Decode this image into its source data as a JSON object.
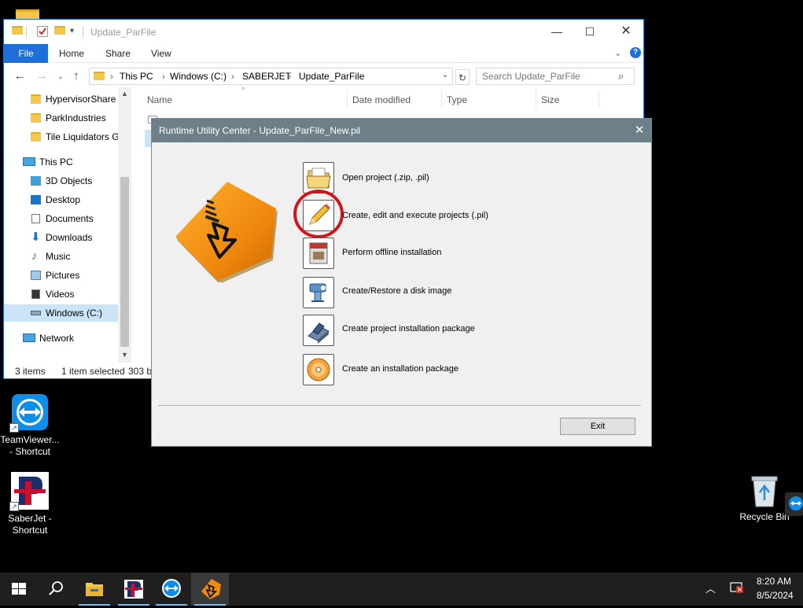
{
  "desktop": {
    "icons": [
      {
        "label": "TeamViewer... - Shortcut"
      },
      {
        "label": "SaberJet - Shortcut"
      },
      {
        "label": "Recycle Bin"
      }
    ]
  },
  "explorer": {
    "title": "Update_ParFile",
    "ribbon_tabs": [
      "File",
      "Home",
      "Share",
      "View"
    ],
    "breadcrumb": [
      "This PC",
      "Windows (C:)",
      "SABERJET",
      "Update_ParFile"
    ],
    "search_placeholder": "Search Update_ParFile",
    "nav_items": [
      {
        "label": "HypervisorShare",
        "icon": "folder-icon"
      },
      {
        "label": "ParkIndustries",
        "icon": "folder-icon"
      },
      {
        "label": "Tile Liquidators G",
        "icon": "folder-icon"
      },
      {
        "label": "This PC",
        "icon": "pc-icon"
      },
      {
        "label": "3D Objects",
        "icon": "cube-icon"
      },
      {
        "label": "Desktop",
        "icon": "desktop-icon"
      },
      {
        "label": "Documents",
        "icon": "document-icon"
      },
      {
        "label": "Downloads",
        "icon": "download-icon"
      },
      {
        "label": "Music",
        "icon": "music-icon"
      },
      {
        "label": "Pictures",
        "icon": "picture-icon"
      },
      {
        "label": "Videos",
        "icon": "video-icon"
      },
      {
        "label": "Windows (C:)",
        "icon": "drive-icon"
      },
      {
        "label": "Network",
        "icon": "network-icon"
      }
    ],
    "columns": [
      "Name",
      "Date modified",
      "Type",
      "Size"
    ],
    "status": {
      "items": "3 items",
      "selected": "1 item selected",
      "size": "303 b"
    }
  },
  "dialog": {
    "title": "Runtime Utility Center - Update_ParFile_New.pil",
    "options": [
      {
        "label": "Open project (.zip, .pil)",
        "icon": "open-folder-icon"
      },
      {
        "label": "Create, edit and execute projects (.pil)",
        "icon": "pencil-icon"
      },
      {
        "label": "Perform offline installation",
        "icon": "offline-install-icon"
      },
      {
        "label": "Create/Restore a disk image",
        "icon": "disk-image-icon"
      },
      {
        "label": "Create project installation package",
        "icon": "package-icon"
      },
      {
        "label": "Create an installation package",
        "icon": "cd-icon"
      }
    ],
    "exit_label": "Exit"
  },
  "taskbar": {
    "time": "8:20 AM",
    "date": "8/5/2024"
  },
  "colors": {
    "accent": "#1e6fd9",
    "dialog_title": "#6d8088",
    "highlight_circle": "#d0161b",
    "logo_orange": "#f08a0e"
  }
}
